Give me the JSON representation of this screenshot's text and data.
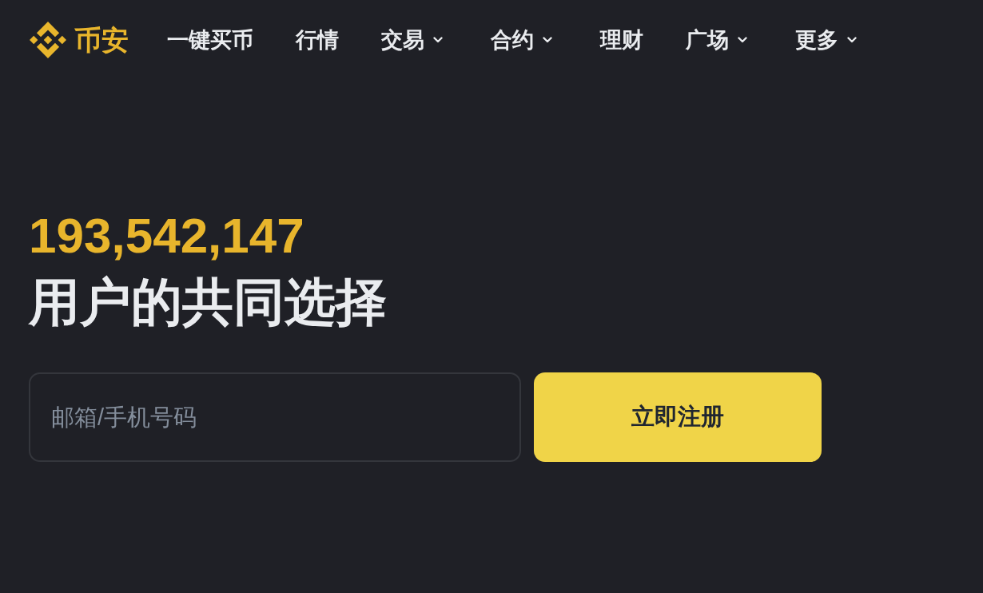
{
  "header": {
    "logo_text": "币安",
    "nav": [
      {
        "label": "一键买币",
        "has_menu": false
      },
      {
        "label": "行情",
        "has_menu": false
      },
      {
        "label": "交易",
        "has_menu": true
      },
      {
        "label": "合约",
        "has_menu": true
      },
      {
        "label": "理财",
        "has_menu": false
      },
      {
        "label": "广场",
        "has_menu": true
      },
      {
        "label": "更多",
        "has_menu": true
      }
    ]
  },
  "hero": {
    "user_count": "193,542,147",
    "tagline": "用户的共同选择"
  },
  "signup": {
    "field": {
      "placeholder": "邮箱/手机号码"
    },
    "button": "立即注册"
  }
}
